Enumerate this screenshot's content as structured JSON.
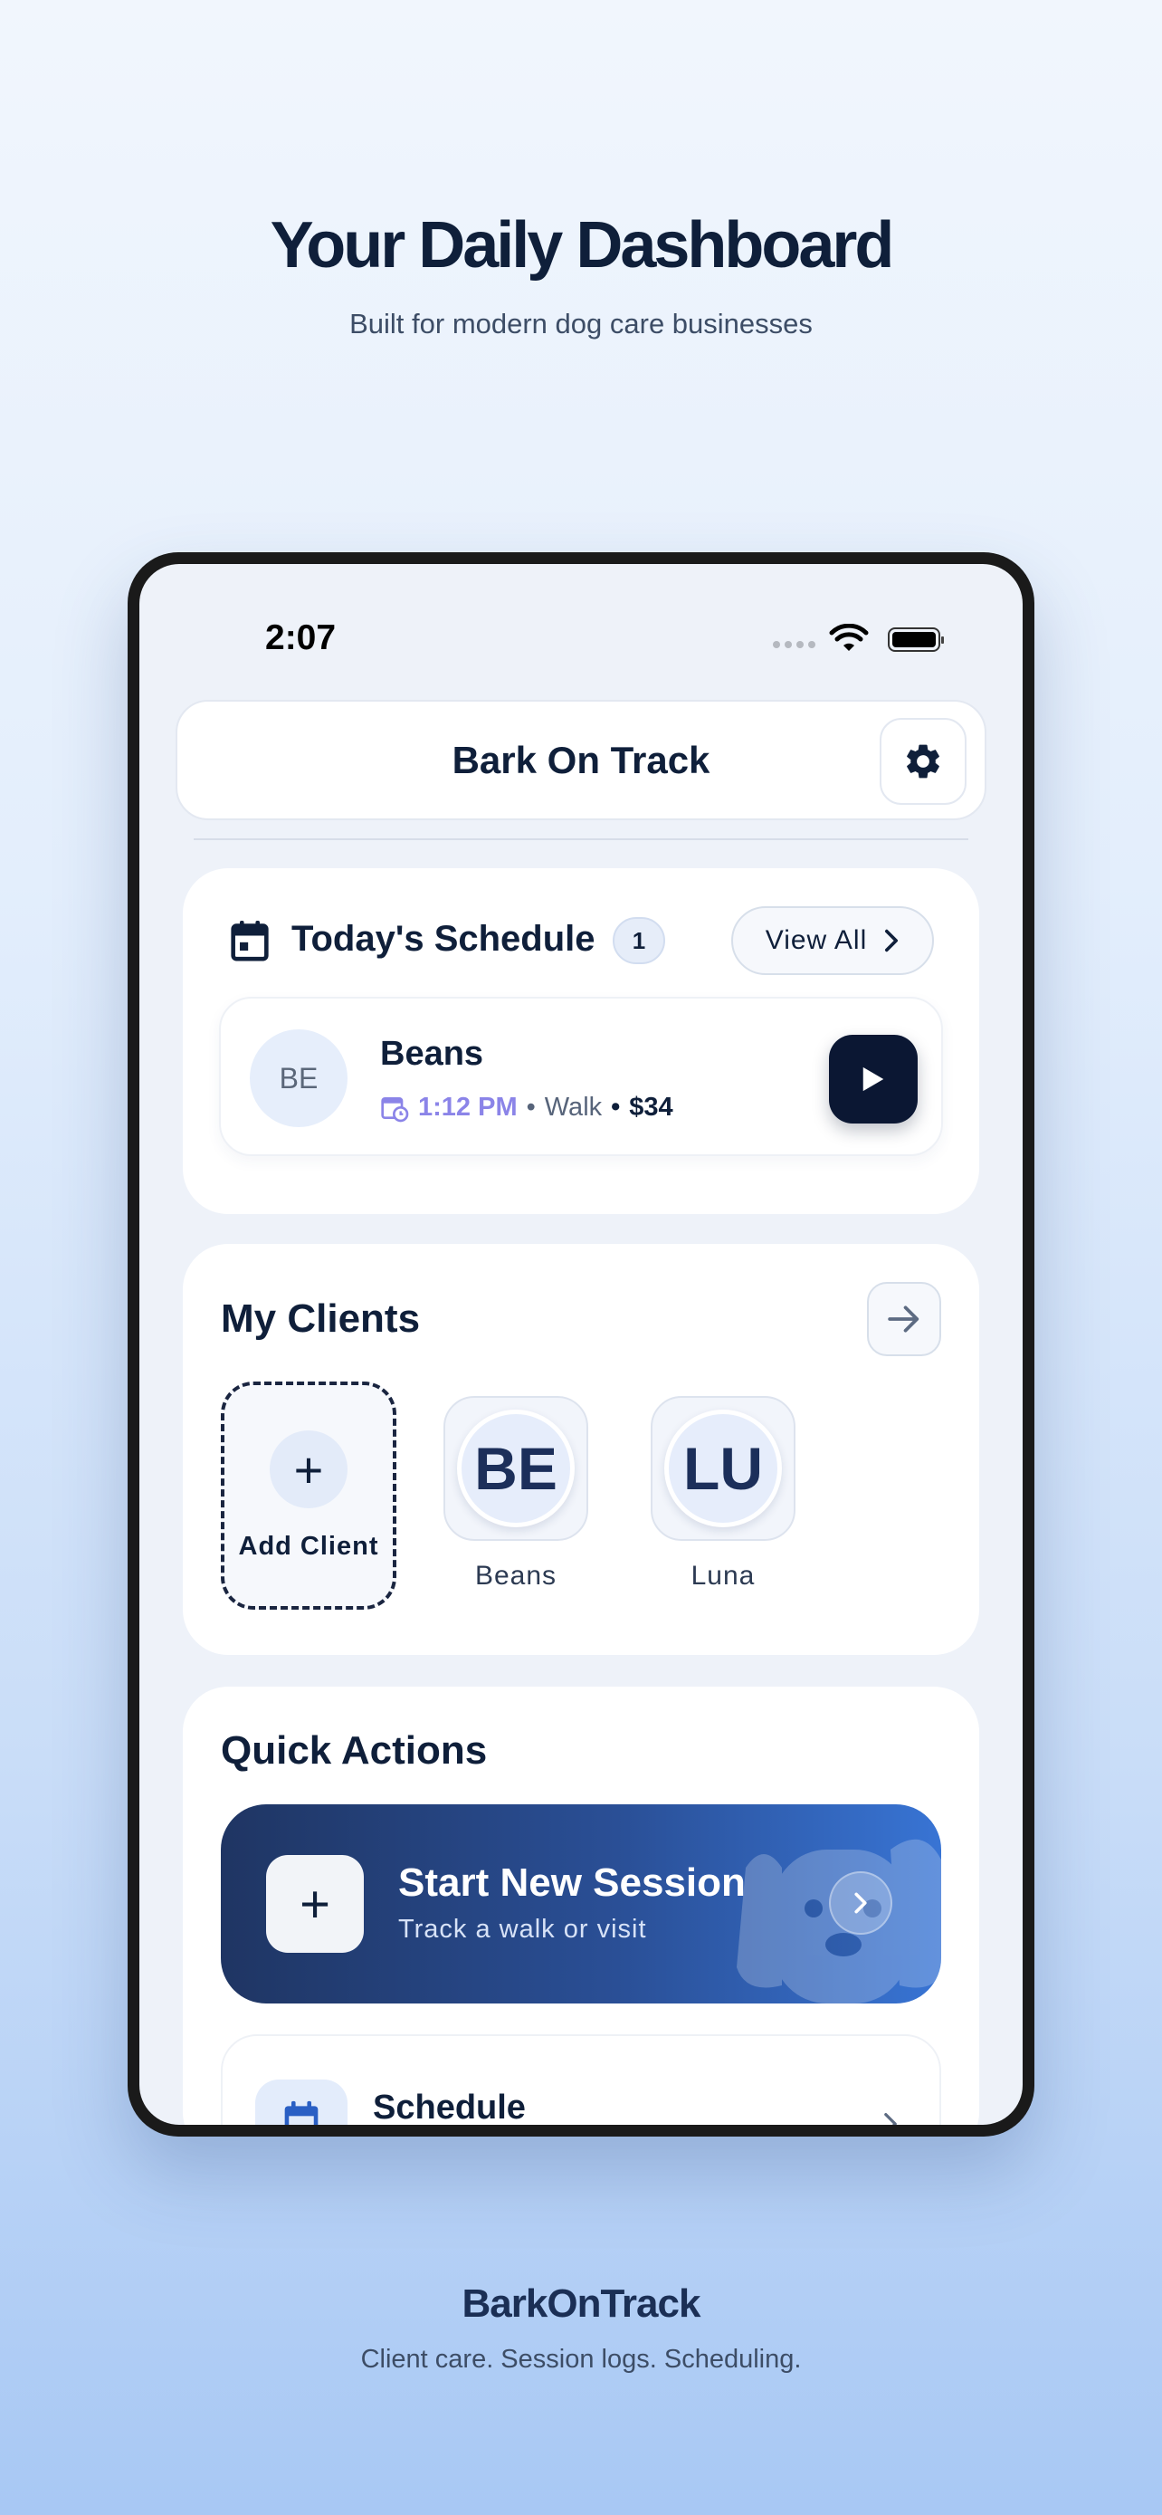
{
  "hero": {
    "title": "Your Daily Dashboard",
    "subtitle": "Built for modern dog care businesses"
  },
  "status_bar": {
    "time": "2:07"
  },
  "app": {
    "title": "Bark On Track"
  },
  "schedule": {
    "heading": "Today's Schedule",
    "count": "1",
    "view_all": "View All",
    "entry": {
      "initials": "BE",
      "name": "Beans",
      "time": "1:12 PM",
      "sep1": "•",
      "service": "Walk",
      "sep2": "•",
      "price": "$34"
    }
  },
  "clients": {
    "heading": "My Clients",
    "add_label": "Add Client",
    "items": [
      {
        "initials": "BE",
        "name": "Beans"
      },
      {
        "initials": "LU",
        "name": "Luna"
      }
    ]
  },
  "quick_actions": {
    "heading": "Quick Actions",
    "session_title": "Start New Session",
    "session_subtitle": "Track a walk or visit",
    "schedule_label": "Schedule"
  },
  "footer": {
    "brand": "BarkOnTrack",
    "tagline": "Client care. Session logs. Scheduling."
  },
  "colors": {
    "navy": "#0f1f3a",
    "accent_blue": "#2a4f96",
    "time_purple": "#8b84e8"
  },
  "icons": [
    "settings-gear-icon",
    "calendar-icon",
    "chevron-right-icon",
    "play-icon",
    "arrow-right-icon",
    "plus-icon",
    "dog-icon",
    "wifi-icon",
    "battery-icon"
  ]
}
